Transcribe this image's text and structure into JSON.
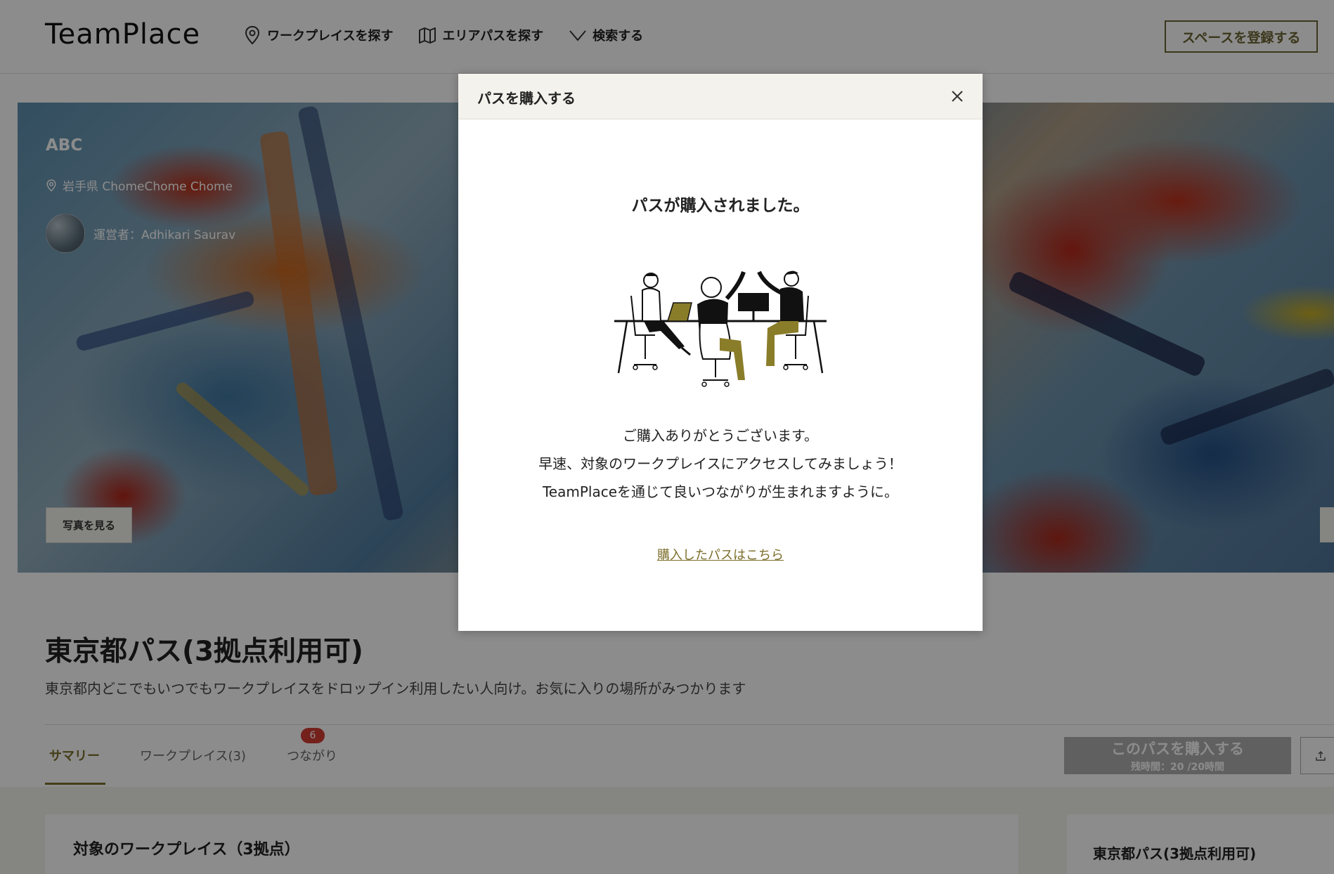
{
  "header": {
    "logo": "TeamPlace",
    "nav": [
      {
        "label": "ワークプレイスを探す",
        "icon": "map-pin-icon"
      },
      {
        "label": "エリアパスを探す",
        "icon": "map-icon"
      },
      {
        "label": "検索する",
        "icon": "chevron-down-icon"
      }
    ],
    "register_label": "スペースを登録する"
  },
  "hero": {
    "title": "ABC",
    "location": "岩手県 ChomeChome Chome",
    "operator": "運営者：Adhikari Saurav",
    "photo_button": "写真を見る"
  },
  "pass": {
    "title": "東京都パス(3拠点利用可)",
    "description": "東京都内どこでもいつでもワークプレイスをドロップイン利用したい人向け。お気に入りの場所がみつかります"
  },
  "tabs": [
    {
      "label": "サマリー",
      "active": true
    },
    {
      "label": "ワークプレイス(3)"
    },
    {
      "label": "つながり",
      "badge": "6"
    }
  ],
  "buy_button": {
    "label": "このパスを購入する",
    "sub": "残時間：20 /20時間"
  },
  "cards": {
    "left_title": "対象のワークプレイス（3拠点）",
    "right_title": "東京都パス(3拠点利用可)"
  },
  "modal": {
    "title": "パスを購入する",
    "heading": "パスが購入されました。",
    "message_lines": [
      "ご購入ありがとうございます。",
      "早速、対象のワークプレイスにアクセスしてみましょう！",
      "TeamPlaceを通じて良いつながりが生まれますように。"
    ],
    "link": "購入したパスはこちら"
  },
  "colors": {
    "accent": "#7c6f2c",
    "badge": "#d33c33",
    "modal_header_bg": "#f3f2ec"
  }
}
